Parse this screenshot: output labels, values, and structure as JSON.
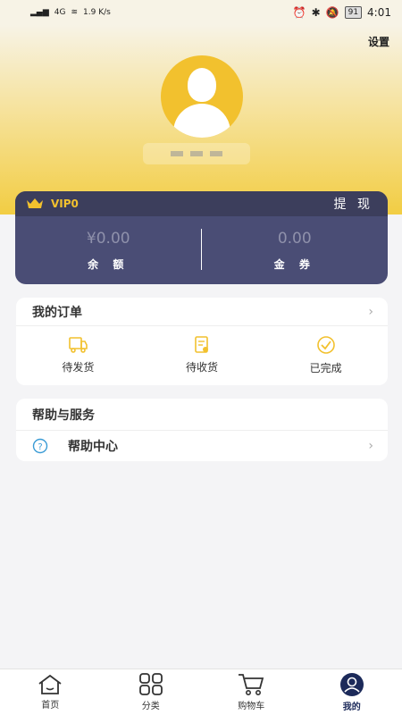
{
  "status_bar": {
    "network": "4G",
    "speed": "1.9 K/s",
    "battery": "91",
    "time": "4:01"
  },
  "header": {
    "settings_label": "设置"
  },
  "vip": {
    "level": "VIP0",
    "withdraw_label": "提 现",
    "balance_value": "¥0.00",
    "balance_label": "余 额",
    "voucher_value": "0.00",
    "voucher_label": "金 券"
  },
  "orders": {
    "title": "我的订单",
    "items": [
      {
        "label": "待发货"
      },
      {
        "label": "待收货"
      },
      {
        "label": "已完成"
      }
    ]
  },
  "services": {
    "title": "帮助与服务",
    "help_label": "帮助中心"
  },
  "nav": {
    "items": [
      {
        "label": "首页"
      },
      {
        "label": "分类"
      },
      {
        "label": "购物车"
      },
      {
        "label": "我的"
      }
    ]
  },
  "colors": {
    "accent_yellow": "#f2c12e",
    "vip_card": "#4a4d75",
    "nav_active": "#1c2a5a"
  }
}
